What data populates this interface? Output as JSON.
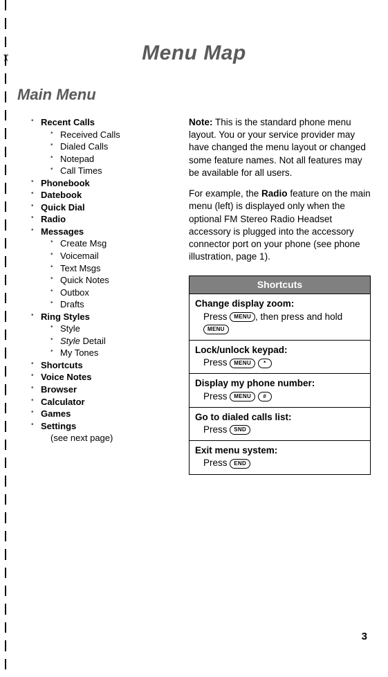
{
  "page": {
    "title": "Menu Map",
    "section": "Main Menu",
    "number": "3"
  },
  "menu": {
    "recent_calls": "Recent Calls",
    "recent_calls_items": {
      "received": "Received Calls",
      "dialed": "Dialed Calls",
      "notepad": "Notepad",
      "call_times": "Call Times"
    },
    "phonebook": "Phonebook",
    "datebook": "Datebook",
    "quick_dial": "Quick Dial",
    "radio": "Radio",
    "messages": "Messages",
    "messages_items": {
      "create": "Create Msg",
      "voicemail": "Voicemail",
      "text": "Text Msgs",
      "quick_notes": "Quick Notes",
      "outbox": "Outbox",
      "drafts": "Drafts"
    },
    "ring_styles": "Ring Styles",
    "ring_styles_items": {
      "style": "Style",
      "style_italic": "Style",
      "detail": " Detail",
      "my_tones": "My Tones"
    },
    "shortcuts": "Shortcuts",
    "voice_notes": "Voice Notes",
    "browser": "Browser",
    "calculator": "Calculator",
    "games": "Games",
    "settings": "Settings",
    "settings_note": "(see next page)"
  },
  "note": {
    "label": "Note:",
    "para1_rest": " This is the standard phone menu layout. You or your service provider may have changed the menu layout or changed some feature names. Not all features may be available for all users.",
    "para2_pre": "For example, the ",
    "para2_bold": "Radio",
    "para2_post": " feature on the main menu (left) is displayed only when the optional FM Stereo Radio Headset accessory is plugged into the accessory connector port on your phone (see phone illustration, page 1)."
  },
  "shortcuts": {
    "header": "Shortcuts",
    "items": [
      {
        "title": "Change display zoom:",
        "desc_pre": "Press ",
        "key1": "MENU",
        "desc_mid": ", then press and hold ",
        "key2": "MENU"
      },
      {
        "title": "Lock/unlock keypad:",
        "desc_pre": "Press ",
        "key1": "MENU",
        "key2": "*"
      },
      {
        "title": "Display my phone number:",
        "desc_pre": "Press ",
        "key1": "MENU",
        "key2": "#"
      },
      {
        "title": "Go to dialed calls list:",
        "desc_pre": "Press ",
        "key1": "SND"
      },
      {
        "title": "Exit menu system:",
        "desc_pre": "Press ",
        "key1": "END"
      }
    ]
  }
}
